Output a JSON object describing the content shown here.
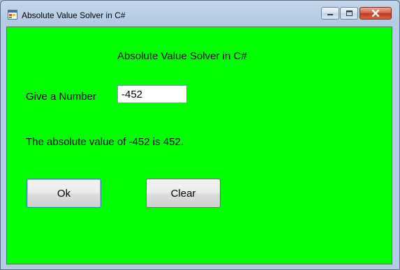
{
  "window": {
    "title": "Absolute Value Solver in C#",
    "icon": "form-icon",
    "caption_buttons": [
      "minimize-icon",
      "maximize-icon",
      "close-icon"
    ]
  },
  "form": {
    "heading": "Absolute Value Solver in C#",
    "number_label": "Give a Number",
    "number_value": "-452",
    "result": "The absolute value of -452 is 452.",
    "ok_label": "Ok",
    "clear_label": "Clear"
  },
  "colors": {
    "form_background": "#00ff00",
    "close_button": "#c1371c"
  }
}
